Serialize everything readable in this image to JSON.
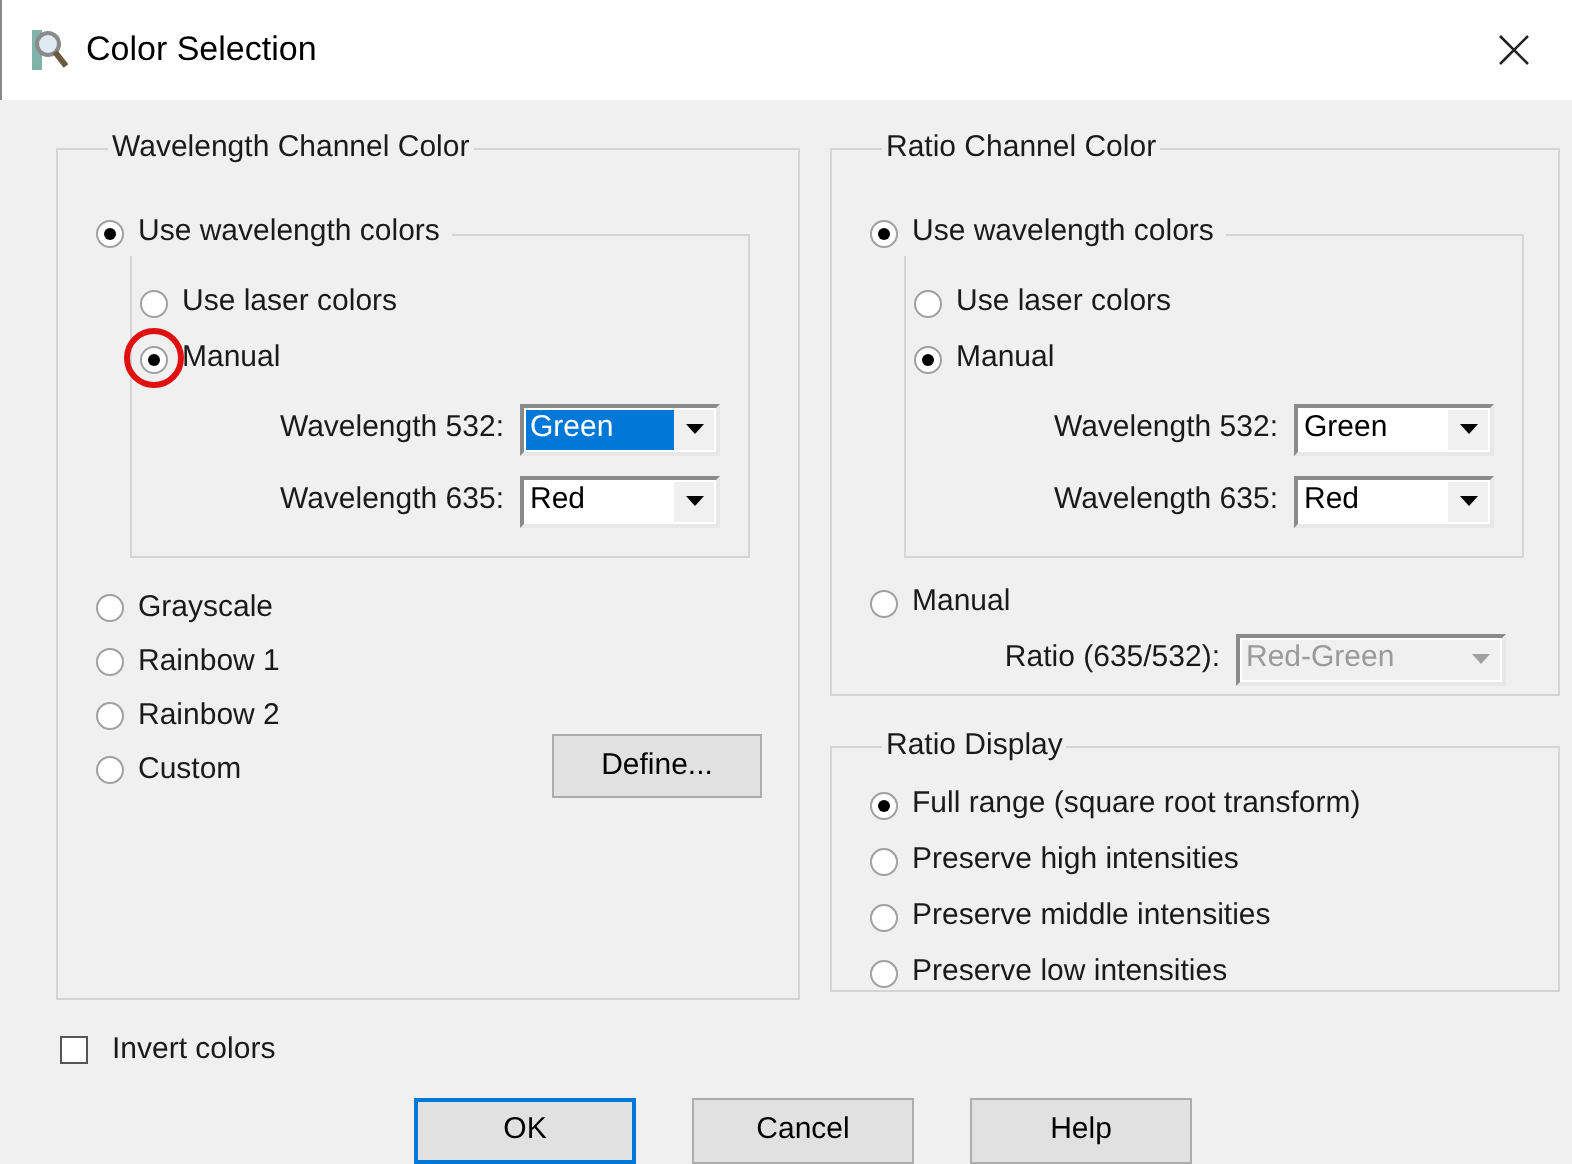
{
  "window": {
    "title": "Color Selection"
  },
  "wavelength_channel_color": {
    "title": "Wavelength Channel Color",
    "main_option": {
      "label": "Use wavelength colors",
      "selected": true
    },
    "sub_options": [
      {
        "label": "Use laser colors",
        "selected": false,
        "highlighted": false
      },
      {
        "label": "Manual",
        "selected": true,
        "highlighted": true
      }
    ],
    "dropdowns": [
      {
        "label": "Wavelength 532:",
        "value": "Green",
        "focused": true
      },
      {
        "label": "Wavelength 635:",
        "value": "Red",
        "focused": false
      }
    ],
    "options": [
      {
        "label": "Grayscale",
        "selected": false
      },
      {
        "label": "Rainbow 1",
        "selected": false
      },
      {
        "label": "Rainbow 2",
        "selected": false
      },
      {
        "label": "Custom",
        "selected": false
      }
    ],
    "define_button": "Define..."
  },
  "ratio_channel_color": {
    "title": "Ratio Channel Color",
    "main_option": {
      "label": "Use wavelength colors",
      "selected": true
    },
    "sub_options": [
      {
        "label": "Use laser colors",
        "selected": false,
        "highlighted": false
      },
      {
        "label": "Manual",
        "selected": true,
        "highlighted": false
      }
    ],
    "dropdowns": [
      {
        "label": "Wavelength 532:",
        "value": "Green",
        "focused": false
      },
      {
        "label": "Wavelength 635:",
        "value": "Red",
        "focused": false
      }
    ],
    "manual_option": {
      "label": "Manual",
      "selected": false
    },
    "ratio_dropdown": {
      "label": "Ratio (635/532):",
      "value": "Red-Green",
      "disabled": true
    }
  },
  "ratio_display": {
    "title": "Ratio Display",
    "options": [
      {
        "label": "Full range (square root transform)",
        "selected": true
      },
      {
        "label": "Preserve high intensities",
        "selected": false
      },
      {
        "label": "Preserve middle intensities",
        "selected": false
      },
      {
        "label": "Preserve low intensities",
        "selected": false
      }
    ]
  },
  "invert_colors": {
    "label": "Invert colors",
    "checked": false
  },
  "buttons": [
    {
      "label": "OK",
      "default": true
    },
    {
      "label": "Cancel",
      "default": false
    },
    {
      "label": "Help",
      "default": false
    }
  ]
}
